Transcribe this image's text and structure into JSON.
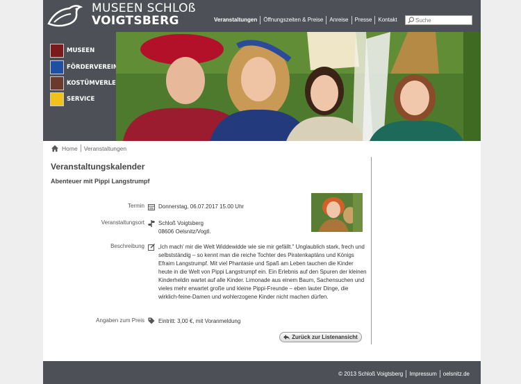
{
  "brand": {
    "line1": "MUSEEN SCHLOß",
    "line2": "VOIGTSBERG"
  },
  "nav": [
    "Veranstaltungen",
    "Öffnungszeiten & Preise",
    "Anreise",
    "Presse",
    "Kontakt"
  ],
  "search": {
    "placeholder": "Suche"
  },
  "sidebar": [
    {
      "label": "MUSEEN",
      "color": "#7a1a1a"
    },
    {
      "label": "FÖRDERVEREIN",
      "color": "#1f4fa3"
    },
    {
      "label": "KOSTÜMVERLEIH",
      "color": "#6b3a2a"
    },
    {
      "label": "SERVICE",
      "color": "#f2c21a"
    }
  ],
  "breadcrumb": {
    "home": "Home",
    "current": "Veranstaltungen"
  },
  "main": {
    "title": "Veranstaltungskalender",
    "subtitle": "Abenteuer mit Pippi Langstrumpf",
    "termin_label": "Termin",
    "termin_value": "Donnerstag, 06.07.2017 15.00 Uhr",
    "ort_label": "Veranstaltungsort",
    "ort_line1": "Schloß Voigtsberg",
    "ort_line2": "08606 Oelsnitz/Vogtl.",
    "beschreibung_label": "Beschreibung",
    "beschreibung_value": "„Ich mach' mir die Welt Widdewidde wie sie mir gefällt.\" Unglaublich stark, frech und selbstständig – so kennt man die reiche Tochter des Piratenkaptäns und Königs Efraim Langstrumpf. Mit viel Phantasie und Spaß am Leben tauchen die Kinder heute in die Welt von Pippi Langstrumpf ein. Ein Erlebnis auf den Spuren der kleinen Kinderheldin wartet auf alle Kinder. Limonade aus einem Baum, Sachensuchen und vieles mehr erwartet große und kleine Pippi-Freunde – eben lauter Dinge, die wirklich-feine-Damen und wohlerzogene Kinder nicht machen dürfen.",
    "preis_label": "Angaben zum Preis",
    "preis_value": "Eintritt: 3,00 €, mit Voranmeldung",
    "back_label": "Zurück zur Listenansicht"
  },
  "footer": [
    "© 2013 Schloß Voigtsberg",
    "Impressum",
    "oelsnitz.de"
  ]
}
